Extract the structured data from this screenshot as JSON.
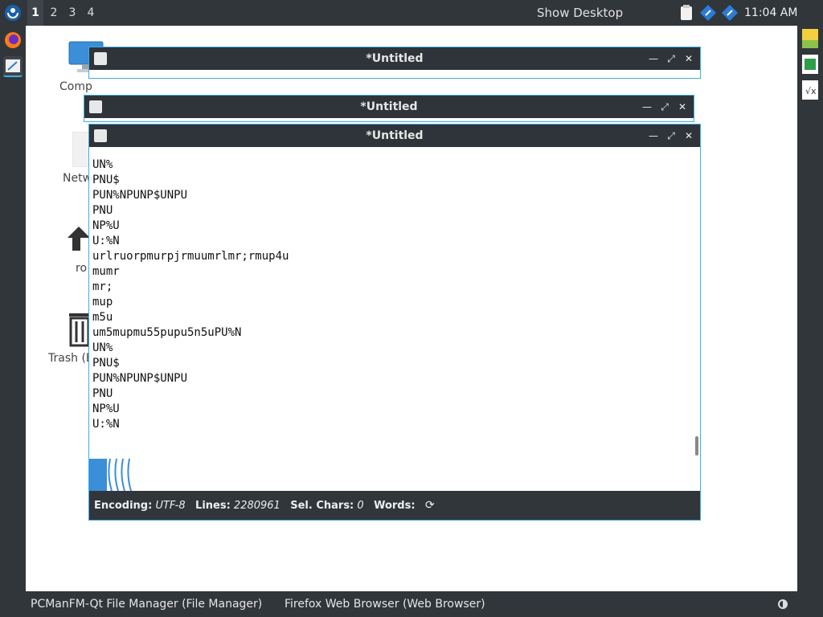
{
  "top_panel": {
    "workspaces": [
      "1",
      "2",
      "3",
      "4"
    ],
    "active_workspace": "1",
    "show_desktop": "Show Desktop",
    "clock": "11:04 AM"
  },
  "desktop": {
    "icons": [
      "Comp",
      "Netw",
      "ro",
      "Trash (E"
    ]
  },
  "windows": {
    "back": {
      "title": "*Untitled"
    },
    "middle": {
      "title": "*Untitled"
    },
    "front": {
      "title": "*Untitled",
      "lines": [
        "UN%",
        "PNU$",
        "PUN%NPUNP$UNPU",
        "PNU",
        "NP%U",
        "U:%N",
        "urlruorpmurpjrmuumrlmr;rmup4u",
        "mumr",
        "mr;",
        "mup",
        "m5u",
        "um5mupmu55pupu5n5uPU%N",
        "UN%",
        "PNU$",
        "PUN%NPUNP$UNPU",
        "PNU",
        "NP%U",
        "U:%N"
      ],
      "status": {
        "encoding_label": "Encoding:",
        "encoding_value": "UTF-8",
        "lines_label": "Lines:",
        "lines_value": "2280961",
        "selchars_label": "Sel. Chars:",
        "selchars_value": "0",
        "words_label": "Words:"
      }
    }
  },
  "bottom_panel": {
    "tasks": [
      "PCManFM-Qt File Manager (File Manager)",
      "Firefox Web Browser (Web Browser)"
    ]
  },
  "colors": {
    "panel": "#31363b",
    "accent": "#3daee9",
    "window_title": "#2f343a"
  }
}
